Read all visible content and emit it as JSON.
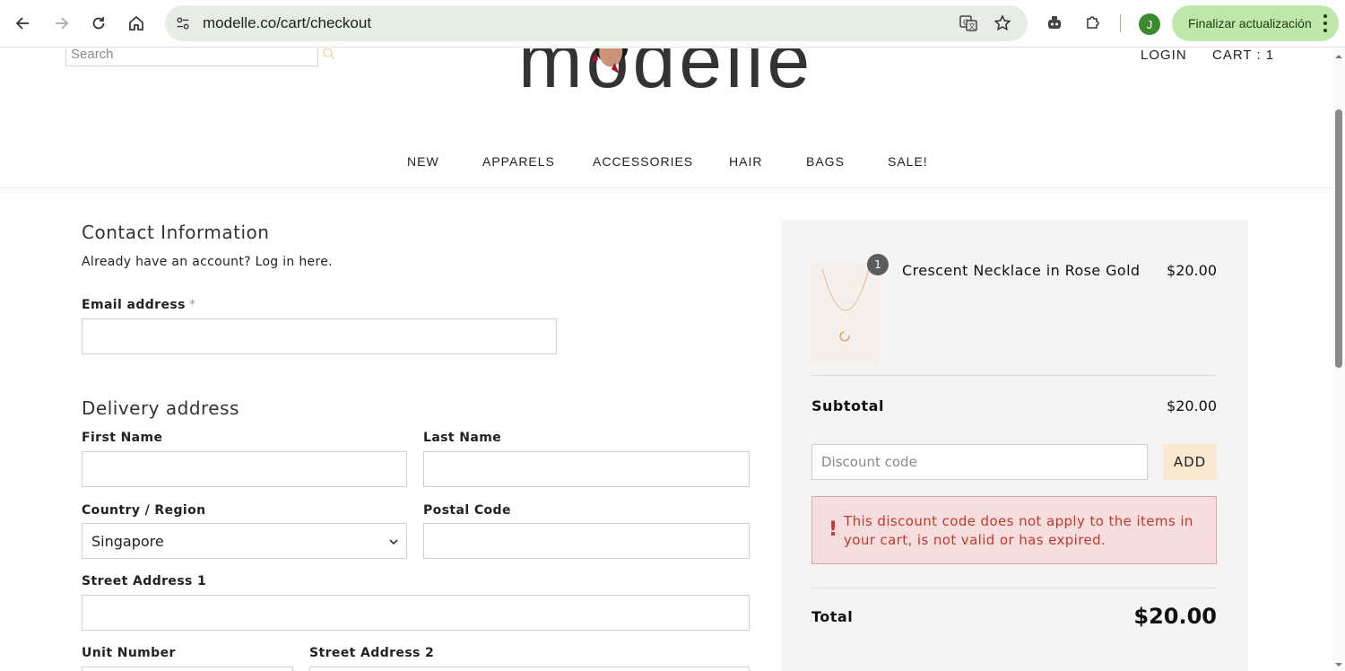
{
  "browser": {
    "url": "modelle.co/cart/checkout",
    "profile_initial": "J",
    "update_button_label": "Finalizar actualización"
  },
  "header": {
    "search_placeholder": "Search",
    "logo_text": "modelle",
    "login_label": "LOGIN",
    "cart_label": "CART : 1"
  },
  "nav": {
    "items": [
      "NEW",
      "APPARELS",
      "ACCESSORIES",
      "HAIR",
      "BAGS",
      "SALE!"
    ]
  },
  "contact": {
    "title": "Contact Information",
    "account_prompt": "Already have an account? Log in here.",
    "email_label": "Email address",
    "email_required_mark": "*",
    "email_value": ""
  },
  "delivery": {
    "title": "Delivery address",
    "first_name_label": "First Name",
    "last_name_label": "Last Name",
    "country_label": "Country / Region",
    "country_value": "Singapore",
    "postal_label": "Postal Code",
    "street1_label": "Street Address 1",
    "unit_label": "Unit Number",
    "street2_label": "Street Address 2"
  },
  "summary": {
    "item": {
      "quantity": "1",
      "name": "Crescent Necklace in Rose Gold",
      "price": "$20.00"
    },
    "subtotal_label": "Subtotal",
    "subtotal_value": "$20.00",
    "discount_placeholder": "Discount code",
    "add_label": "ADD",
    "error_icon": "!",
    "error_message": "This discount code does not apply to the items in your cart, is not valid or has expired.",
    "total_label": "Total",
    "total_value": "$20.00"
  },
  "colors": {
    "accent_add_button": "#fbe8d0",
    "error_text": "#c0392b",
    "error_bg": "#f7dede",
    "update_button": "#bfe7a9"
  }
}
